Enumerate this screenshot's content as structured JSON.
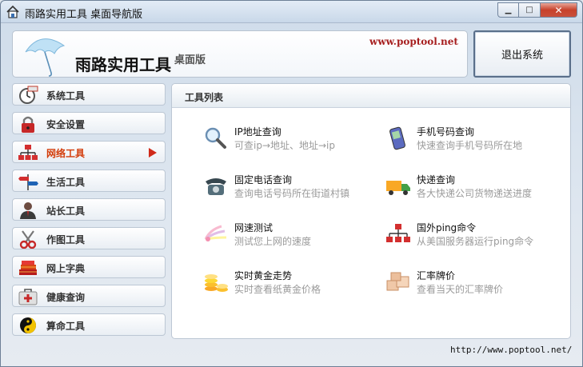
{
  "window": {
    "title": "雨路实用工具 桌面导航版"
  },
  "header": {
    "brand": "雨路实用工具",
    "edition": "桌面版",
    "url": "www.poptool.net"
  },
  "exit_button": {
    "label": "退出系统"
  },
  "sidebar": {
    "items": [
      {
        "label": "系统工具",
        "icon": "clock-icon"
      },
      {
        "label": "安全设置",
        "icon": "lock-icon"
      },
      {
        "label": "网络工具",
        "icon": "network-icon",
        "active": true
      },
      {
        "label": "生活工具",
        "icon": "signpost-icon"
      },
      {
        "label": "站长工具",
        "icon": "webmaster-icon"
      },
      {
        "label": "作图工具",
        "icon": "scissors-icon"
      },
      {
        "label": "网上字典",
        "icon": "books-icon"
      },
      {
        "label": "健康查询",
        "icon": "medkit-icon"
      },
      {
        "label": "算命工具",
        "icon": "yinyang-icon"
      }
    ]
  },
  "content": {
    "title": "工具列表",
    "tools": [
      {
        "name": "IP地址查询",
        "desc": "可查ip→地址、地址→ip",
        "icon": "magnifier-icon"
      },
      {
        "name": "手机号码查询",
        "desc": "快速查询手机号码所在地",
        "icon": "mobile-phone-icon"
      },
      {
        "name": "固定电话查询",
        "desc": "查询电话号码所在街道村镇",
        "icon": "telephone-icon"
      },
      {
        "name": "快递查询",
        "desc": "各大快递公司货物递送进度",
        "icon": "truck-icon"
      },
      {
        "name": "网速测试",
        "desc": "测试您上网的速度",
        "icon": "speed-swirl-icon"
      },
      {
        "name": "国外ping命令",
        "desc": "从美国服务器运行ping命令",
        "icon": "network-icon"
      },
      {
        "name": "实时黄金走势",
        "desc": "实时查看纸黄金价格",
        "icon": "gold-coins-icon"
      },
      {
        "name": "汇率牌价",
        "desc": "查看当天的汇率牌价",
        "icon": "exchange-boxes-icon"
      }
    ]
  },
  "footer": {
    "url": "http://www.poptool.net/"
  }
}
